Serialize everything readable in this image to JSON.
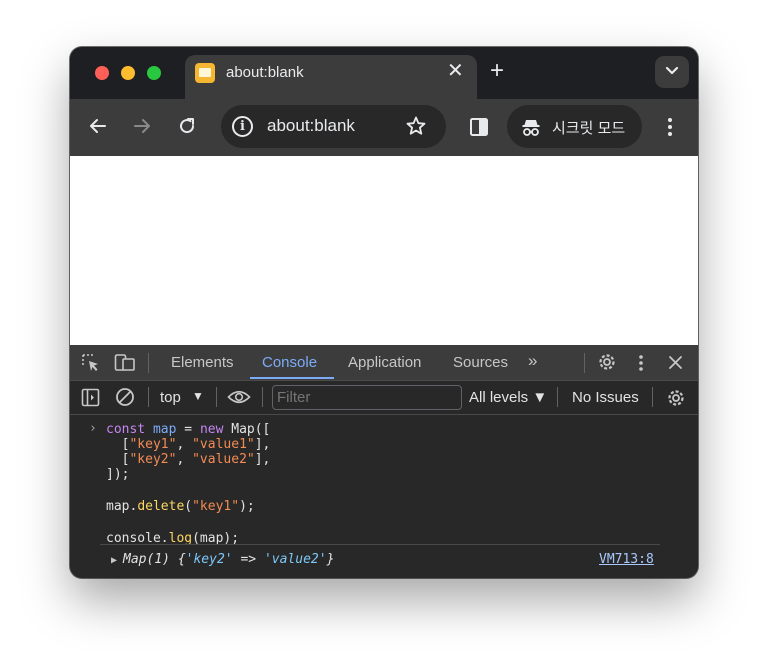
{
  "tab": {
    "title": "about:blank",
    "close": "✕"
  },
  "new_tab": "+",
  "omnibox": {
    "url": "about:blank",
    "info": "i"
  },
  "incognito": {
    "label": "시크릿 모드"
  },
  "devtools": {
    "tabs": [
      "Elements",
      "Console",
      "Application",
      "Sources"
    ],
    "more_tabs": "»",
    "active_tab": "Console",
    "context": "top",
    "context_arrow": "▼",
    "filter_placeholder": "Filter",
    "levels": "All levels ▼",
    "issues": "No Issues"
  },
  "console": {
    "prompt": "›",
    "lines": [
      [
        {
          "t": "const",
          "c": "kw"
        },
        {
          "t": " "
        },
        {
          "t": "map",
          "c": "var"
        },
        {
          "t": " = "
        },
        {
          "t": "new",
          "c": "kw"
        },
        {
          "t": " Map(["
        }
      ],
      [
        {
          "t": "  ["
        },
        {
          "t": "\"key1\"",
          "c": "str"
        },
        {
          "t": ", "
        },
        {
          "t": "\"value1\"",
          "c": "str"
        },
        {
          "t": "],"
        }
      ],
      [
        {
          "t": "  ["
        },
        {
          "t": "\"key2\"",
          "c": "str"
        },
        {
          "t": ", "
        },
        {
          "t": "\"value2\"",
          "c": "str"
        },
        {
          "t": "],"
        }
      ],
      [
        {
          "t": "]);"
        }
      ],
      [
        {
          "t": ""
        }
      ],
      [
        {
          "t": "map."
        },
        {
          "t": "delete",
          "c": "fn"
        },
        {
          "t": "("
        },
        {
          "t": "\"key1\"",
          "c": "str"
        },
        {
          "t": ");"
        }
      ],
      [
        {
          "t": ""
        }
      ],
      [
        {
          "t": "console."
        },
        {
          "t": "log",
          "c": "fn"
        },
        {
          "t": "(map);"
        }
      ]
    ],
    "result": {
      "triangle": "▶",
      "prefix": "Map(1) {",
      "key": "'key2'",
      "arrow": " => ",
      "value": "'value2'",
      "suffix": "}"
    },
    "source_link": "VM713:8"
  },
  "colors": {
    "keyword": "#c586f3",
    "variable": "#7cacf8",
    "string": "#f28b54",
    "function": "#fdd663",
    "active_tab": "#7cacf8"
  }
}
